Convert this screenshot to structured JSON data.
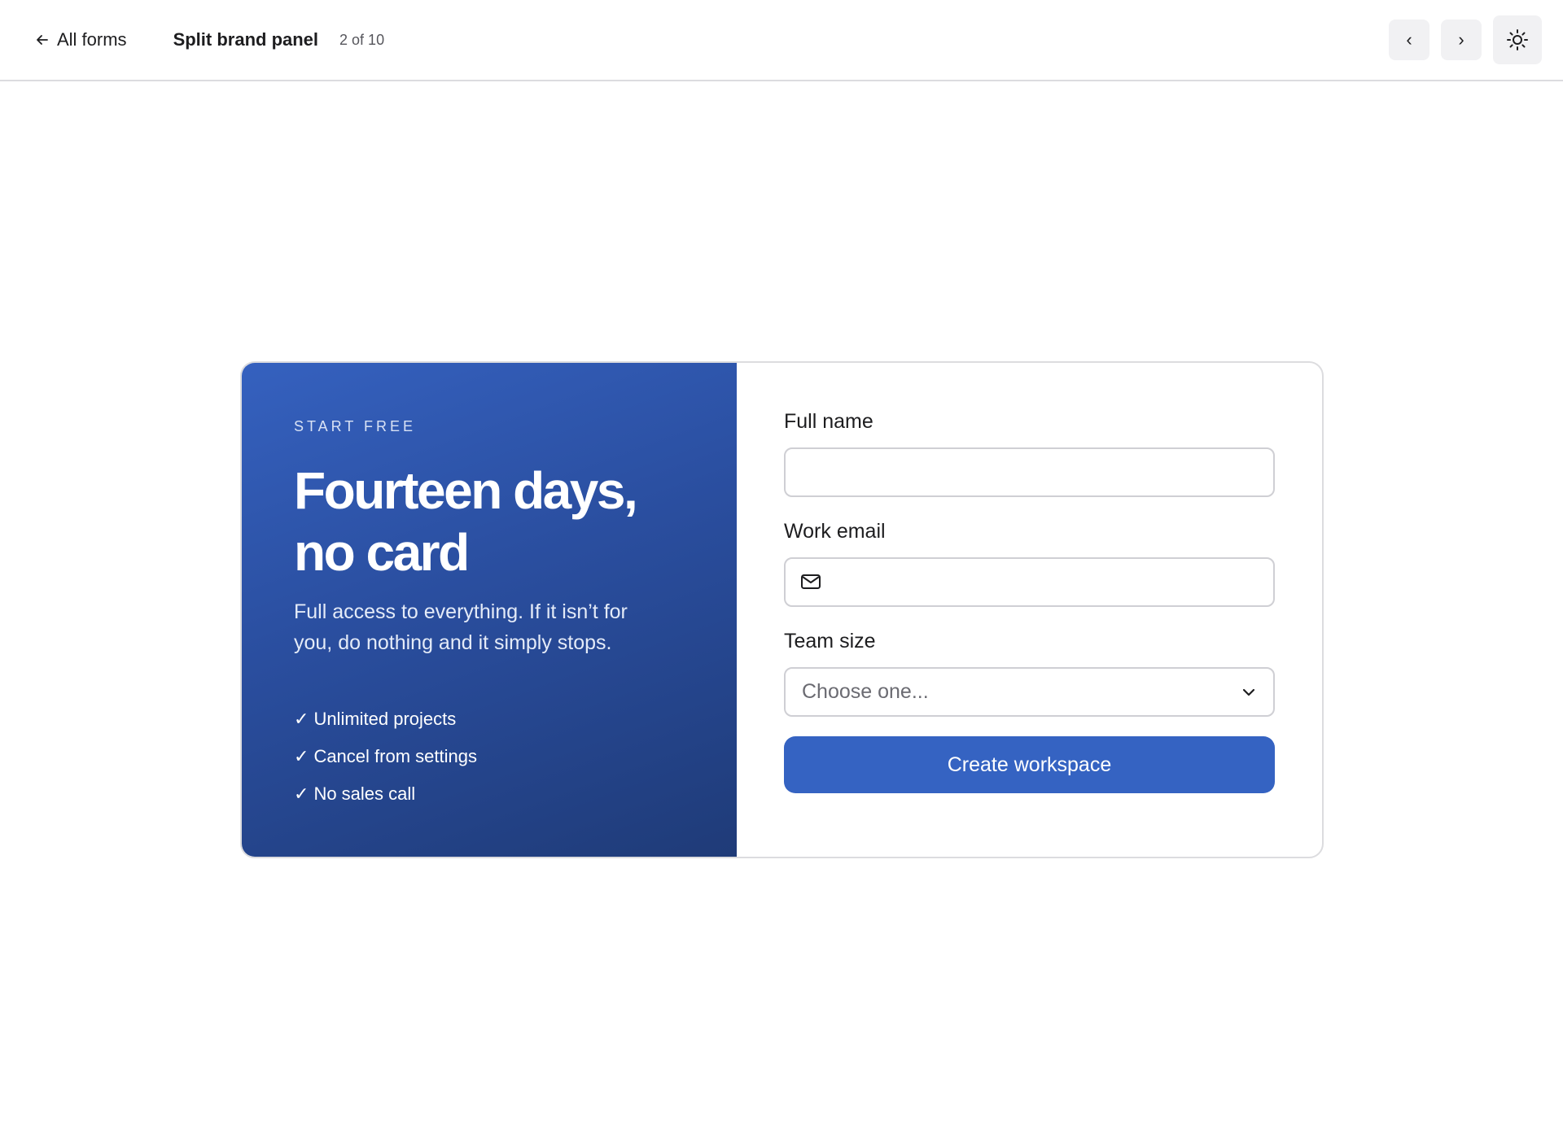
{
  "topbar": {
    "back_label": "All forms",
    "title": "Split brand panel",
    "counter": "2 of 10",
    "prev_label": "‹",
    "next_label": "›",
    "prev_icon": "chevron-left-icon",
    "next_icon": "chevron-right-icon",
    "theme_icon": "sun-icon"
  },
  "brand": {
    "eyebrow": "START FREE",
    "headline_line1": "Fourteen days,",
    "headline_line2": "no card",
    "lead": "Full access to everything. If it isn’t for you, do nothing and it simply stops.",
    "check_glyph": "✓",
    "features": [
      "Unlimited projects",
      "Cancel from settings",
      "No sales call"
    ],
    "gradient_start": "#3561bf",
    "gradient_end": "#1f3b78"
  },
  "form": {
    "full_name_label": "Full name",
    "full_name_value": "",
    "work_email_label": "Work email",
    "work_email_value": "",
    "team_size_label": "Team size",
    "team_size_placeholder": "Choose one...",
    "submit_label": "Create workspace",
    "accent_color": "#3563c2"
  }
}
